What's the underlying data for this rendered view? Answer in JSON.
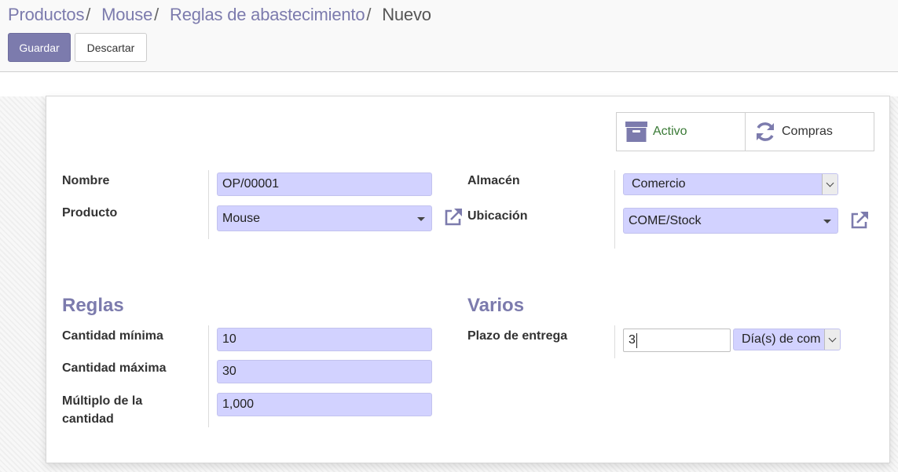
{
  "breadcrumb": {
    "items": [
      "Productos",
      "Mouse",
      "Reglas de abastecimiento"
    ],
    "separator": "/",
    "current": "Nuevo"
  },
  "buttons": {
    "save": "Guardar",
    "discard": "Descartar"
  },
  "smart_buttons": {
    "active": {
      "label": "Activo",
      "icon": "archive-icon"
    },
    "purchases": {
      "label": "Compras",
      "icon": "refresh-icon"
    }
  },
  "form": {
    "left": {
      "name_label": "Nombre",
      "name_value": "OP/00001",
      "product_label": "Producto",
      "product_value": "Mouse"
    },
    "right": {
      "warehouse_label": "Almacén",
      "warehouse_value": "Comercio",
      "location_label": "Ubicación",
      "location_value": "COME/Stock"
    }
  },
  "rules": {
    "title": "Reglas",
    "min_qty_label": "Cantidad mínima",
    "min_qty_value": "10",
    "max_qty_label": "Cantidad máxima",
    "max_qty_value": "30",
    "multiple_label_line1": "Múltiplo de la",
    "multiple_label_line2": "cantidad",
    "multiple_value": "1,000"
  },
  "misc": {
    "title": "Varios",
    "lead_time_label": "Plazo de entrega",
    "lead_time_value": "3",
    "lead_time_unit": "Día(s) de com"
  },
  "colors": {
    "brand": "#7c7bad",
    "required_field_bg": "#d2d2ff",
    "active_text": "#3a7a36"
  }
}
